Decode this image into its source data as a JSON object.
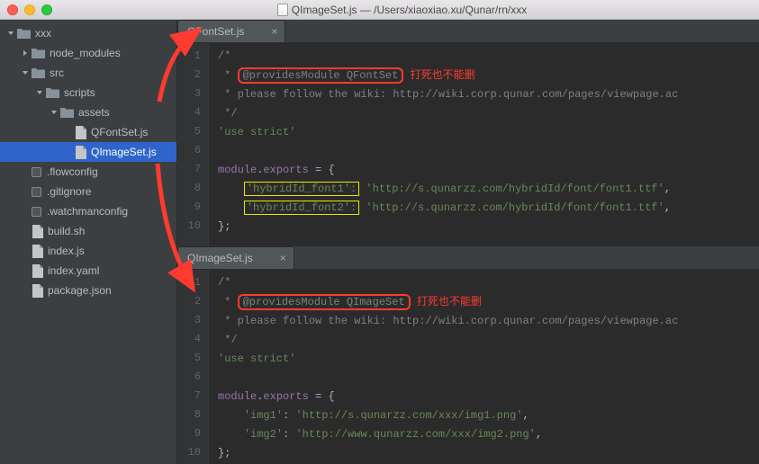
{
  "window": {
    "title": "QImageSet.js — /Users/xiaoxiao.xu/Qunar/rn/xxx"
  },
  "sidebar": {
    "items": [
      {
        "type": "folder",
        "name": "xxx",
        "expanded": true,
        "indent": 0
      },
      {
        "type": "folder",
        "name": "node_modules",
        "expanded": false,
        "indent": 1
      },
      {
        "type": "folder",
        "name": "src",
        "expanded": true,
        "indent": 1
      },
      {
        "type": "folder",
        "name": "scripts",
        "expanded": true,
        "indent": 2
      },
      {
        "type": "folder",
        "name": "assets",
        "expanded": true,
        "indent": 3
      },
      {
        "type": "file",
        "name": "QFontSet.js",
        "indent": 4,
        "selected": false
      },
      {
        "type": "file",
        "name": "QImageSet.js",
        "indent": 4,
        "selected": true
      },
      {
        "type": "dotfile",
        "name": ".flowconfig",
        "indent": 1
      },
      {
        "type": "dotfile",
        "name": ".gitignore",
        "indent": 1
      },
      {
        "type": "dotfile",
        "name": ".watchmanconfig",
        "indent": 1
      },
      {
        "type": "file",
        "name": "build.sh",
        "indent": 1
      },
      {
        "type": "file",
        "name": "index.js",
        "indent": 1
      },
      {
        "type": "file",
        "name": "index.yaml",
        "indent": 1
      },
      {
        "type": "file",
        "name": "package.json",
        "indent": 1
      }
    ]
  },
  "editor1": {
    "tab": "QFontSet.js",
    "lines": [
      "1",
      "2",
      "3",
      "4",
      "5",
      "6",
      "7",
      "8",
      "9",
      "10"
    ],
    "c1": "/*",
    "c2a": " * ",
    "c2b": "@providesModule QFontSet",
    "c2annot": "打死也不能删",
    "c3": " * please follow the wiki: http://wiki.corp.qunar.com/pages/viewpage.ac",
    "c4": " */",
    "c5": "'use strict'",
    "c7a": "module",
    "c7b": ".",
    "c7c": "exports",
    "c7d": " = {",
    "c8a": "'hybridId_font1':",
    "c8b": " 'http://s.qunarzz.com/hybridId/font/font1.ttf'",
    "c8c": ",",
    "c9a": "'hybridId_font2':",
    "c9b": " 'http://s.qunarzz.com/hybridId/font/font1.ttf'",
    "c9c": ",",
    "c10": "};"
  },
  "editor2": {
    "tab": "QImageSet.js",
    "lines": [
      "1",
      "2",
      "3",
      "4",
      "5",
      "6",
      "7",
      "8",
      "9",
      "10"
    ],
    "c1": "/*",
    "c2a": " * ",
    "c2b": "@providesModule QImageSet",
    "c2annot": "打死也不能删",
    "c3": " * please follow the wiki: http://wiki.corp.qunar.com/pages/viewpage.ac",
    "c4": " */",
    "c5": "'use strict'",
    "c7a": "module",
    "c7b": ".",
    "c7c": "exports",
    "c7d": " = {",
    "c8a": "'img1'",
    "c8b": ": ",
    "c8c": "'http://s.qunarzz.com/xxx/img1.png'",
    "c8d": ",",
    "c9a": "'img2'",
    "c9b": ": ",
    "c9c": "'http://www.qunarzz.com/xxx/img2.png'",
    "c9d": ",",
    "c10": "};"
  }
}
